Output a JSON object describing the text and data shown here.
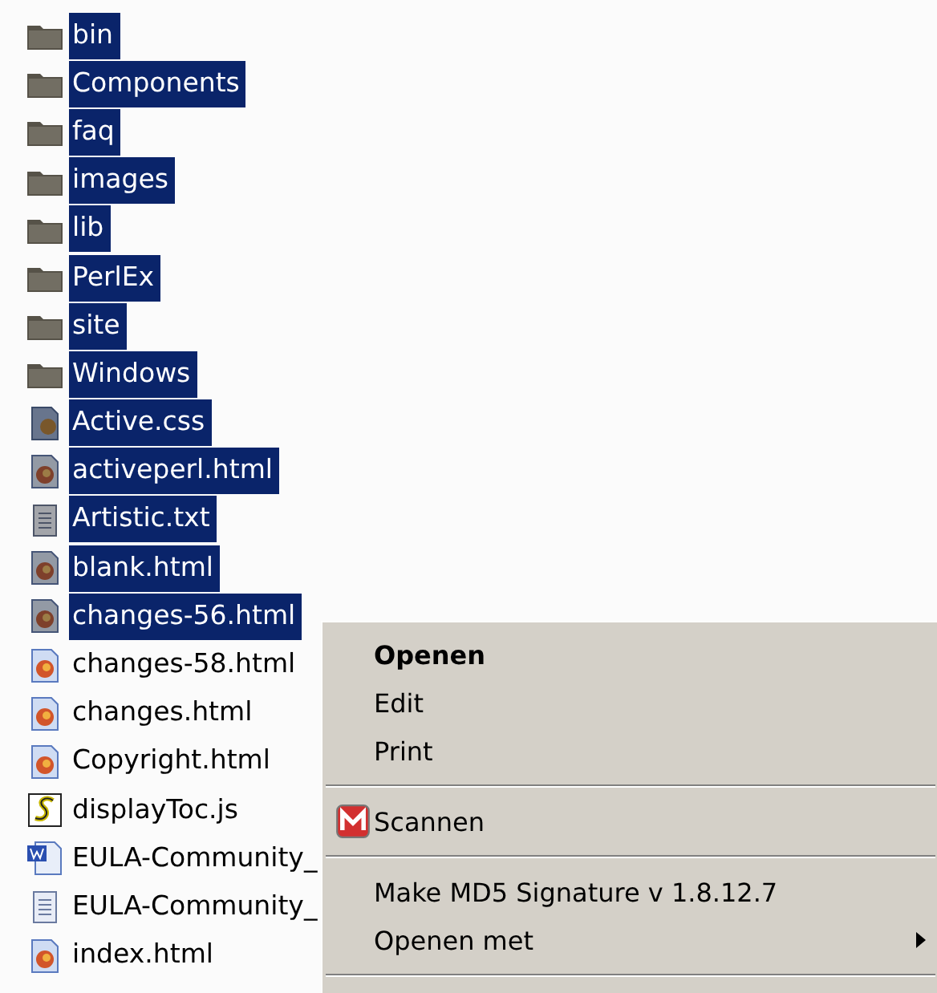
{
  "files": [
    {
      "name": "bin",
      "kind": "folder",
      "selected": true
    },
    {
      "name": "Components",
      "kind": "folder",
      "selected": true
    },
    {
      "name": "faq",
      "kind": "folder",
      "selected": true
    },
    {
      "name": "images",
      "kind": "folder",
      "selected": true
    },
    {
      "name": "lib",
      "kind": "folder",
      "selected": true
    },
    {
      "name": "PerlEx",
      "kind": "folder",
      "selected": true
    },
    {
      "name": "site",
      "kind": "folder",
      "selected": true
    },
    {
      "name": "Windows",
      "kind": "folder",
      "selected": true
    },
    {
      "name": "Active.css",
      "kind": "css",
      "selected": true
    },
    {
      "name": "activeperl.html",
      "kind": "html",
      "selected": true
    },
    {
      "name": "Artistic.txt",
      "kind": "txt",
      "selected": true
    },
    {
      "name": "blank.html",
      "kind": "html",
      "selected": true
    },
    {
      "name": "changes-56.html",
      "kind": "html",
      "selected": true
    },
    {
      "name": "changes-58.html",
      "kind": "html",
      "selected": false
    },
    {
      "name": "changes.html",
      "kind": "html",
      "selected": false
    },
    {
      "name": "Copyright.html",
      "kind": "html",
      "selected": false
    },
    {
      "name": "displayToc.js",
      "kind": "js",
      "selected": false
    },
    {
      "name": "EULA-Community_",
      "kind": "doc",
      "selected": false
    },
    {
      "name": "EULA-Community_",
      "kind": "txt",
      "selected": false
    },
    {
      "name": "index.html",
      "kind": "html",
      "selected": false
    }
  ],
  "context_menu": {
    "items": [
      {
        "kind": "item",
        "label": "Openen",
        "default": true
      },
      {
        "kind": "item",
        "label": "Edit",
        "default": false
      },
      {
        "kind": "item",
        "label": "Print",
        "default": false
      },
      {
        "kind": "separator"
      },
      {
        "kind": "scan",
        "label": "Scannen",
        "default": false
      },
      {
        "kind": "separator"
      },
      {
        "kind": "item",
        "label": "Make MD5 Signature v 1.8.12.7",
        "default": false
      },
      {
        "kind": "submenu",
        "label": "Openen met",
        "default": false
      },
      {
        "kind": "separator"
      }
    ]
  }
}
